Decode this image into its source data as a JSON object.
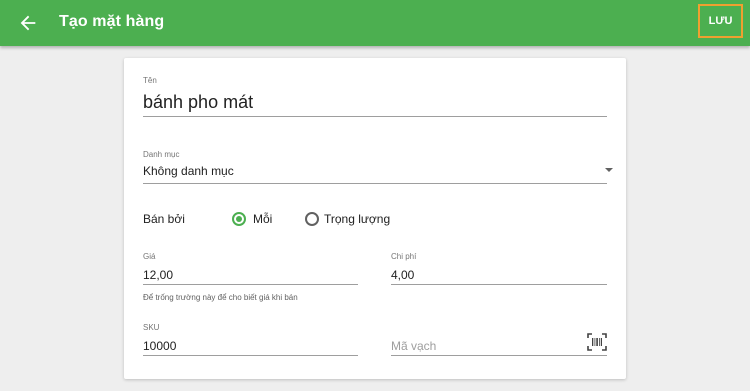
{
  "appbar": {
    "title": "Tạo mặt hàng",
    "save_label": "LƯU",
    "back_icon": "arrow-left-icon"
  },
  "colors": {
    "primary": "#4caf50",
    "highlight": "#f0a030"
  },
  "form": {
    "name": {
      "label": "Tên",
      "value": "bánh pho mát"
    },
    "category": {
      "label": "Danh mục",
      "value": "Không danh mục"
    },
    "sold_by": {
      "label": "Bán bởi",
      "options": [
        {
          "label": "Mỗi",
          "checked": true
        },
        {
          "label": "Trọng lượng",
          "checked": false
        }
      ]
    },
    "price": {
      "label": "Giá",
      "value": "12,00",
      "hint": "Để trống trường này để cho biết giá khi bán"
    },
    "cost": {
      "label": "Chi phí",
      "value": "4,00"
    },
    "sku": {
      "label": "SKU",
      "value": "10000"
    },
    "barcode": {
      "placeholder": "Mã vạch",
      "icon": "barcode-scan-icon"
    }
  }
}
